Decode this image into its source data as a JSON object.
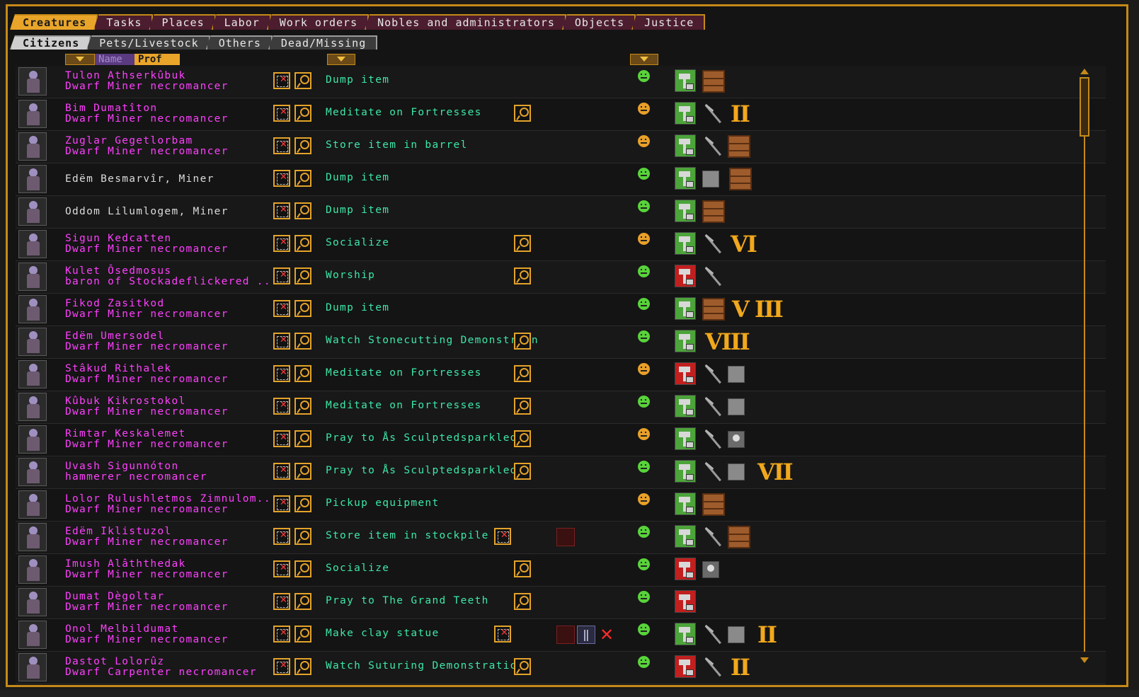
{
  "tabs": [
    {
      "label": "Creatures",
      "active": true
    },
    {
      "label": "Tasks",
      "active": false
    },
    {
      "label": "Places",
      "active": false
    },
    {
      "label": "Labor",
      "active": false
    },
    {
      "label": "Work orders",
      "active": false
    },
    {
      "label": "Nobles and administrators",
      "active": false
    },
    {
      "label": "Objects",
      "active": false
    },
    {
      "label": "Justice",
      "active": false
    }
  ],
  "subtabs": [
    {
      "label": "Citizens",
      "active": true
    },
    {
      "label": "Pets/Livestock",
      "active": false
    },
    {
      "label": "Others",
      "active": false
    },
    {
      "label": "Dead/Missing",
      "active": false
    }
  ],
  "sort": {
    "name_label": "Name",
    "prof_label": "Prof"
  },
  "colors": {
    "accent": "#c48a18",
    "name": "#ff40ff",
    "task": "#3de8a8",
    "numeral": "#f2a81c"
  },
  "rows": [
    {
      "name": "Tulon Athserkûbuk",
      "prof": "Dwarf Miner necromancer",
      "task": "Dump item",
      "mood": "happy",
      "labor": "green",
      "equip": [
        "chest"
      ],
      "squad": "",
      "task_mag": false
    },
    {
      "name": "Bim Dumatîton",
      "prof": "Dwarf Miner necromancer",
      "task": "Meditate on Fortresses",
      "mood": "ok",
      "labor": "green",
      "equip": [
        "pick"
      ],
      "squad": "II",
      "task_mag": true
    },
    {
      "name": "Zuglar Gegetlorbam",
      "prof": "Dwarf Miner necromancer",
      "task": "Store item in barrel",
      "mood": "ok",
      "labor": "green",
      "equip": [
        "pick",
        "chest"
      ],
      "squad": "",
      "task_mag": false
    },
    {
      "name": "Edëm Besmarvîr, Miner",
      "prof": "",
      "task": "Dump item",
      "mood": "happy",
      "labor": "green",
      "equip": [
        "block",
        "chest"
      ],
      "squad": "",
      "task_mag": false
    },
    {
      "name": "Oddom Lilumlogem, Miner",
      "prof": "",
      "task": "Dump item",
      "mood": "happy",
      "labor": "green",
      "equip": [
        "chest"
      ],
      "squad": "",
      "task_mag": false
    },
    {
      "name": "Sigun Kedcatten",
      "prof": "Dwarf Miner necromancer",
      "task": "Socialize",
      "mood": "ok",
      "labor": "green",
      "equip": [
        "pick"
      ],
      "squad": "VI",
      "task_mag": true
    },
    {
      "name": "Kulet Ôsedmosus",
      "prof": "baron of Stockadeflickered ...",
      "task": "Worship",
      "mood": "happy",
      "labor": "red",
      "equip": [
        "pick"
      ],
      "squad": "",
      "task_mag": true
    },
    {
      "name": "Fikod Zasitkod",
      "prof": "Dwarf Miner necromancer",
      "task": "Dump item",
      "mood": "happy",
      "labor": "green",
      "equip": [
        "chest"
      ],
      "squad": "V  III",
      "task_mag": false
    },
    {
      "name": "Edëm Umersodel",
      "prof": "Dwarf Miner necromancer",
      "task": "Watch Stonecutting Demonstr   on",
      "mood": "happy",
      "labor": "green",
      "equip": [],
      "squad": "VIII",
      "task_mag": true
    },
    {
      "name": "Stâkud Rithalek",
      "prof": "Dwarf Miner necromancer",
      "task": "Meditate on Fortresses",
      "mood": "ok",
      "labor": "red",
      "equip": [
        "pick",
        "block"
      ],
      "squad": "",
      "task_mag": true
    },
    {
      "name": "Kûbuk Kikrostokol",
      "prof": "Dwarf Miner necromancer",
      "task": "Meditate on Fortresses",
      "mood": "happy",
      "labor": "green",
      "equip": [
        "pick",
        "block"
      ],
      "squad": "",
      "task_mag": true
    },
    {
      "name": "Rimtar Keskalemet",
      "prof": "Dwarf Miner necromancer",
      "task": "Pray to Ås Sculptedsparkled",
      "mood": "ok",
      "labor": "green",
      "equip": [
        "pick",
        "skull"
      ],
      "squad": "",
      "task_mag": true
    },
    {
      "name": "Uvash Sigunnóton",
      "prof": "hammerer necromancer",
      "task": "Pray to Ås Sculptedsparkled",
      "mood": "happy",
      "labor": "green",
      "equip": [
        "pick",
        "block"
      ],
      "squad": "VII",
      "task_mag": true
    },
    {
      "name": "Lolor Rulushletmos Zimnulom...",
      "prof": "Dwarf Miner necromancer",
      "task": "Pickup equipment",
      "mood": "ok",
      "labor": "green",
      "equip": [
        "chest"
      ],
      "squad": "",
      "task_mag": false
    },
    {
      "name": "Edëm Iklistuzol",
      "prof": "Dwarf Miner necromancer",
      "task": "Store item in stockpile",
      "mood": "happy",
      "labor": "green",
      "equip": [
        "pick",
        "chest"
      ],
      "squad": "",
      "task_mag": false,
      "task_go": true,
      "extra": [
        "x"
      ]
    },
    {
      "name": "Imush Alâththedak",
      "prof": "Dwarf Miner necromancer",
      "task": "Socialize",
      "mood": "happy",
      "labor": "red",
      "equip": [
        "skull"
      ],
      "squad": "",
      "task_mag": true
    },
    {
      "name": "Dumat Dègoltar",
      "prof": "Dwarf Miner necromancer",
      "task": "Pray to The Grand Teeth",
      "mood": "happy",
      "labor": "red",
      "equip": [],
      "squad": "",
      "task_mag": true
    },
    {
      "name": "Onol Melbildumat",
      "prof": "Dwarf Miner necromancer",
      "task": "Make clay statue",
      "mood": "happy",
      "labor": "green",
      "equip": [
        "pick",
        "block"
      ],
      "squad": "II",
      "task_mag": false,
      "task_go": true,
      "extra": [
        "x",
        "pause",
        "cancel"
      ]
    },
    {
      "name": "Dastot Lolorûz",
      "prof": "Dwarf Carpenter necromancer",
      "task": "Watch Suturing Demonstratio",
      "mood": "happy",
      "labor": "red",
      "equip": [
        "pick"
      ],
      "squad": "II",
      "task_mag": true
    }
  ]
}
